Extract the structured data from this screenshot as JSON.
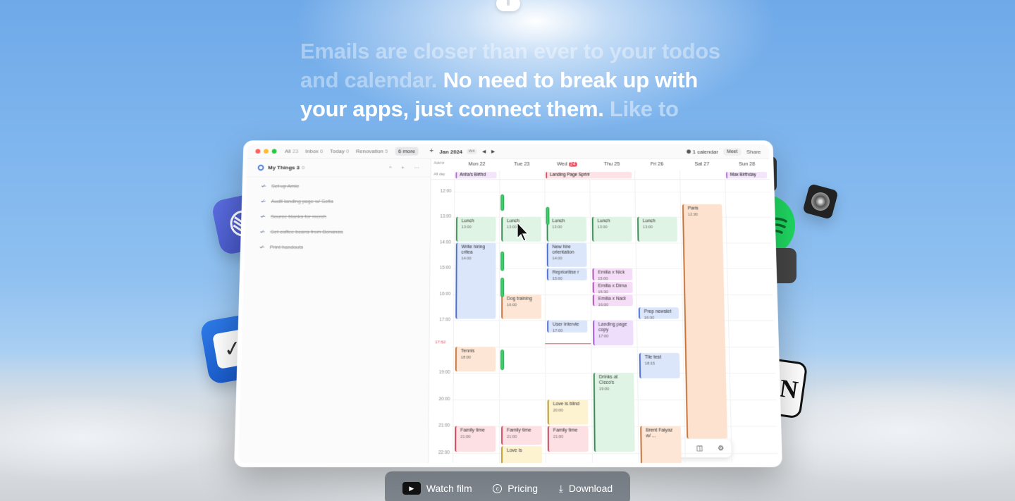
{
  "headline": {
    "part1": "Emails are closer than ever to your todos and calendar.",
    "part2": "No need to break up with your apps, just connect them.",
    "part3": "Like to"
  },
  "titlebar": {
    "tabs": [
      {
        "label": "All",
        "count": "23"
      },
      {
        "label": "Inbox",
        "count": "6"
      },
      {
        "label": "Today",
        "count": "0"
      },
      {
        "label": "Renovation",
        "count": "5"
      },
      {
        "label": "6 more",
        "count": ""
      }
    ],
    "add": "+"
  },
  "calendar_header": {
    "month": "Jan 2024",
    "week": "W4",
    "prev": "◀",
    "next": "▶",
    "calendars_label": "1 calendar",
    "meet": "Meet",
    "share": "Share"
  },
  "sidebar": {
    "list_title": "My Things 3",
    "list_count": "0",
    "collapse": "^",
    "add": "+",
    "more": "···",
    "todos": [
      "Set up Amie",
      "Audit landing page w/ Sofia",
      "Source blanks for merch",
      "Get coffee beans from Bonanza",
      "Print handouts"
    ]
  },
  "calendar": {
    "addtz_label": "Add tz",
    "allday_label": "All day",
    "days": [
      {
        "name": "Mon",
        "num": "22"
      },
      {
        "name": "Tue",
        "num": "23"
      },
      {
        "name": "Wed",
        "num": "24",
        "today": true
      },
      {
        "name": "Thu",
        "num": "25"
      },
      {
        "name": "Fri",
        "num": "26"
      },
      {
        "name": "Sat",
        "num": "27"
      },
      {
        "name": "Sun",
        "num": "28"
      }
    ],
    "hours": [
      "12:00",
      "13:00",
      "14:00",
      "15:00",
      "16:00",
      "17:00",
      "",
      "19:00",
      "20:00",
      "21:00",
      "22:00"
    ],
    "now_label": "17:52",
    "allday_events": [
      {
        "title": "Anita's Birthd",
        "day": 0,
        "span": 1,
        "color": "#f3e6fb",
        "bar": "#b76ad8"
      },
      {
        "title": "Landing Page Sprint",
        "day": 2,
        "span": 2,
        "color": "#fde3e6",
        "bar": "#e64a5c"
      },
      {
        "title": "Max Birthday",
        "day": 6,
        "span": 1,
        "color": "#f3e6fb",
        "bar": "#b76ad8"
      }
    ],
    "events": [
      {
        "title": "Lunch",
        "time": "13:00",
        "day": 0,
        "start": 13,
        "end": 14,
        "bg": "#dff4e4",
        "bar": "#3a8a55"
      },
      {
        "title": "Lunch",
        "time": "13:00",
        "day": 1,
        "start": 13,
        "end": 14,
        "bg": "#dff4e4",
        "bar": "#3a8a55"
      },
      {
        "title": "Lunch",
        "time": "13:00",
        "day": 2,
        "start": 13,
        "end": 14,
        "bg": "#dff4e4",
        "bar": "#3a8a55"
      },
      {
        "title": "Lunch",
        "time": "13:00",
        "day": 3,
        "start": 13,
        "end": 14,
        "bg": "#dff4e4",
        "bar": "#3a8a55"
      },
      {
        "title": "Lunch",
        "time": "13:00",
        "day": 4,
        "start": 13,
        "end": 14,
        "bg": "#dff4e4",
        "bar": "#3a8a55"
      },
      {
        "title": "Write hiring critea",
        "time": "14:00",
        "day": 0,
        "start": 14,
        "end": 17,
        "bg": "#dbe6fb",
        "bar": "#4b6fd0"
      },
      {
        "title": "New hire orientation",
        "time": "14:00",
        "day": 2,
        "start": 14,
        "end": 15,
        "bg": "#dbe6fb",
        "bar": "#4b6fd0"
      },
      {
        "title": "Reprioritise r",
        "time": "15:00",
        "day": 2,
        "start": 15,
        "end": 15.5,
        "bg": "#dbe6fb",
        "bar": "#4b6fd0"
      },
      {
        "title": "Emilia x Nick",
        "time": "15:00",
        "day": 3,
        "start": 15,
        "end": 15.5,
        "bg": "#f6ddf7",
        "bar": "#b44bc0"
      },
      {
        "title": "Emilia x Dima",
        "time": "15:30",
        "day": 3,
        "start": 15.5,
        "end": 16,
        "bg": "#f6ddf7",
        "bar": "#b44bc0"
      },
      {
        "title": "Emilia x Nadi",
        "time": "16:00",
        "day": 3,
        "start": 16,
        "end": 16.5,
        "bg": "#f6ddf7",
        "bar": "#b44bc0"
      },
      {
        "title": "Dog training",
        "time": "16:00",
        "day": 1,
        "start": 16,
        "end": 17,
        "bg": "#fde6d6",
        "bar": "#c7733a"
      },
      {
        "title": "Prep newslet",
        "time": "16:30",
        "day": 4,
        "start": 16.5,
        "end": 17,
        "bg": "#dbe6fb",
        "bar": "#4b6fd0"
      },
      {
        "title": "User intervie",
        "time": "17:00",
        "day": 2,
        "start": 17,
        "end": 17.5,
        "bg": "#dbe6fb",
        "bar": "#4b6fd0"
      },
      {
        "title": "Landing page copy",
        "time": "17:00",
        "day": 3,
        "start": 17,
        "end": 18,
        "bg": "#efdefb",
        "bar": "#a05ad0"
      },
      {
        "title": "Tennis",
        "time": "18:00",
        "day": 0,
        "start": 18,
        "end": 19,
        "bg": "#fde6d6",
        "bar": "#c7733a"
      },
      {
        "title": "Tile test",
        "time": "18:15",
        "day": 4,
        "start": 18.25,
        "end": 19.25,
        "bg": "#dbe6fb",
        "bar": "#4b6fd0"
      },
      {
        "title": "Drinks at Cicco's",
        "time": "19:00",
        "day": 3,
        "start": 19,
        "end": 22,
        "bg": "#dff4e4",
        "bar": "#3a8a55"
      },
      {
        "title": "Love is blind",
        "time": "20:00",
        "day": 2,
        "start": 20,
        "end": 21,
        "bg": "#fdf3d1",
        "bar": "#b89a2a"
      },
      {
        "title": "Family time",
        "time": "21:00",
        "day": 0,
        "start": 21,
        "end": 22,
        "bg": "#fde0e3",
        "bar": "#c9475a"
      },
      {
        "title": "Family time",
        "time": "21:00",
        "day": 1,
        "start": 21,
        "end": 21.75,
        "bg": "#fde0e3",
        "bar": "#c9475a"
      },
      {
        "title": "Family time",
        "time": "21:00",
        "day": 2,
        "start": 21,
        "end": 22,
        "bg": "#fde0e3",
        "bar": "#c9475a"
      },
      {
        "title": "Love is",
        "time": "",
        "day": 1,
        "start": 21.75,
        "end": 23,
        "bg": "#fdf3d1",
        "bar": "#b89a2a"
      },
      {
        "title": "Brent Faiyaz w/ ...",
        "time": "",
        "day": 4,
        "start": 21,
        "end": 23,
        "bg": "#fde6d6",
        "bar": "#c7733a"
      },
      {
        "title": "Paris",
        "time": "12:30",
        "day": 5,
        "start": 12.5,
        "end": 21.5,
        "bg": "#fde3cf",
        "bar": "#c7733a"
      }
    ]
  },
  "bottom_bar": {
    "watch": "Watch film",
    "pricing": "Pricing",
    "download": "Download"
  },
  "colors": {
    "accent": "#4b7bd8",
    "today": "#e64a5c"
  }
}
